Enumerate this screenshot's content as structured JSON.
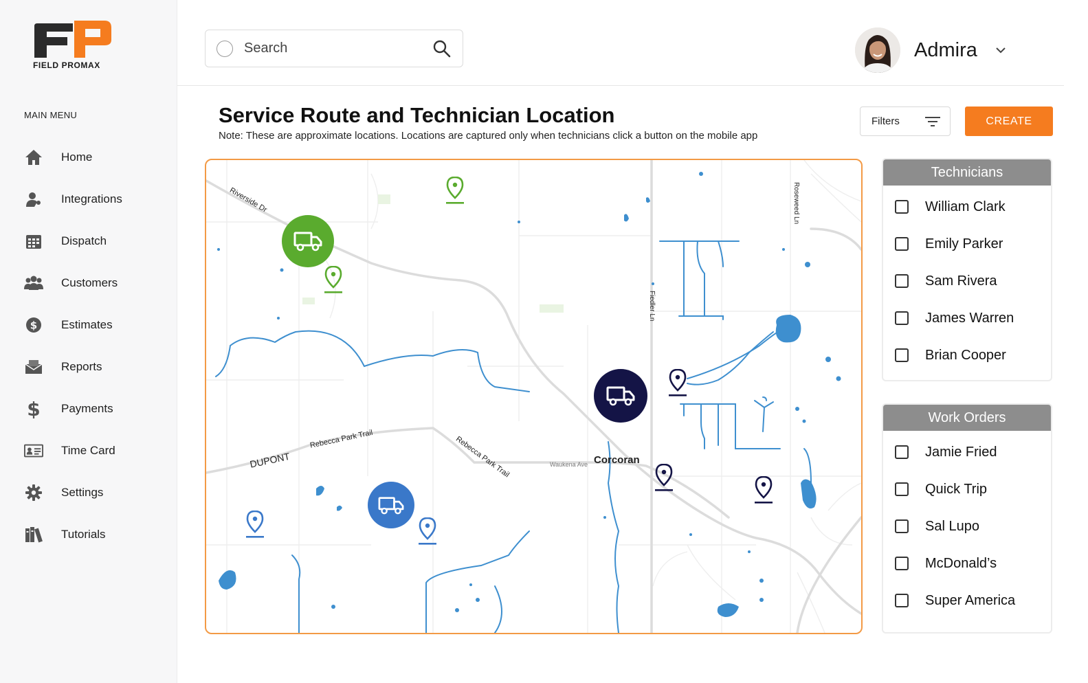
{
  "brand": {
    "logo_text": "FIELD PROMAX",
    "primary_color": "#f57c1f",
    "dark_color": "#2b2b2b"
  },
  "sidebar": {
    "heading": "MAIN MENU",
    "items": [
      {
        "label": "Home",
        "icon": "home-icon"
      },
      {
        "label": "Integrations",
        "icon": "user-icon"
      },
      {
        "label": "Dispatch",
        "icon": "calendar-icon"
      },
      {
        "label": "Customers",
        "icon": "customers-icon"
      },
      {
        "label": "Estimates",
        "icon": "dollar-circle-icon"
      },
      {
        "label": "Reports",
        "icon": "envelope-icon"
      },
      {
        "label": "Payments",
        "icon": "dollar-icon"
      },
      {
        "label": "Time Card",
        "icon": "id-card-icon"
      },
      {
        "label": "Settings",
        "icon": "gear-icon"
      },
      {
        "label": "Tutorials",
        "icon": "books-icon"
      }
    ]
  },
  "search": {
    "placeholder": "Search"
  },
  "user": {
    "name": "Admira"
  },
  "page": {
    "title": "Service Route and Technician Location",
    "note": "Note: These are approximate locations.  Locations are captured only when technicians click a button on the mobile app"
  },
  "toolbar": {
    "filters_label": "Filters",
    "create_label": "CREATE"
  },
  "map": {
    "labels": {
      "riverside": "Riverside Dr",
      "rebecca1": "Rebecca Park Trail",
      "rebecca2": "Rebecca Park Trail",
      "dupont": "DUPONT",
      "waukena": "Waukena Ave",
      "corcoran": "Corcoran",
      "fiedler": "Fiedler Ln",
      "roseweed": "Roseweed Ln"
    },
    "colors": {
      "green": "#5aab2e",
      "navy": "#141446",
      "blue": "#3a78c9",
      "water": "#3e8fcf"
    }
  },
  "technicians": {
    "title": "Technicians",
    "items": [
      "William Clark",
      "Emily Parker",
      "Sam Rivera",
      "James Warren",
      "Brian Cooper"
    ]
  },
  "work_orders": {
    "title": "Work Orders",
    "items": [
      "Jamie Fried",
      "Quick Trip",
      "Sal Lupo",
      "McDonald’s",
      "Super America"
    ]
  }
}
